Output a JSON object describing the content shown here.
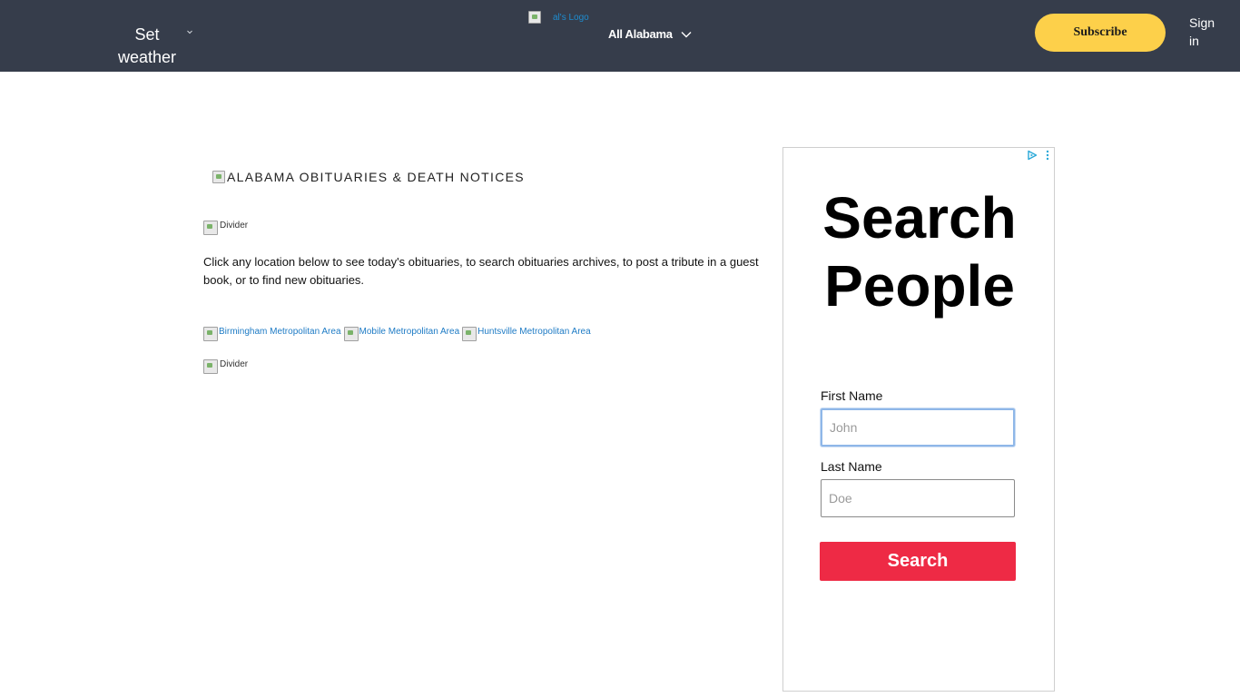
{
  "header": {
    "weather_label": "Set weather",
    "logo_alt": "al's Logo",
    "region_label": "All Alabama",
    "subscribe_label": "Subscribe",
    "signin_label": "Sign in",
    "colors": {
      "bar": "#363d4b",
      "subscribe": "#fdd04a",
      "logo_link": "#1e8ccf"
    }
  },
  "main": {
    "title_alt": "ALABAMA OBITUARIES & DEATH NOTICES",
    "divider_alt": "Divider",
    "intro_text": "Click any location below to see today's obituaries, to search obituaries archives, to post a tribute in a guest book, or to find new obituaries.",
    "areas": [
      {
        "label": "Birmingham Metropolitan Area"
      },
      {
        "label": "Mobile Metropolitan Area"
      },
      {
        "label": "Huntsville Metropolitan Area"
      }
    ],
    "link_color": "#1e7bc5"
  },
  "ad": {
    "heading": "Search People",
    "first_name_label": "First Name",
    "first_name_placeholder": "John",
    "first_name_value": "",
    "last_name_label": "Last Name",
    "last_name_placeholder": "Doe",
    "last_name_value": "",
    "search_label": "Search",
    "button_color": "#ee2a45",
    "adchoices_icon": "adchoices-icon"
  }
}
